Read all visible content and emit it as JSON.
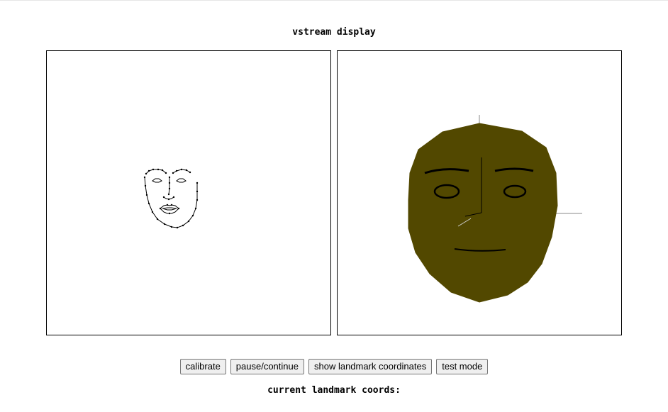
{
  "page": {
    "title": "vstream display"
  },
  "panels": {
    "left": {
      "description_icon": "face-landmark-wireframe"
    },
    "right": {
      "description_icon": "face-3d-mesh",
      "face_color": "#524800"
    }
  },
  "buttons": {
    "calibrate": "calibrate",
    "pause_continue": "pause/continue",
    "show_landmarks": "show landmark coordinates",
    "test_mode": "test mode"
  },
  "status": {
    "coords_label": "current landmark coords:"
  }
}
